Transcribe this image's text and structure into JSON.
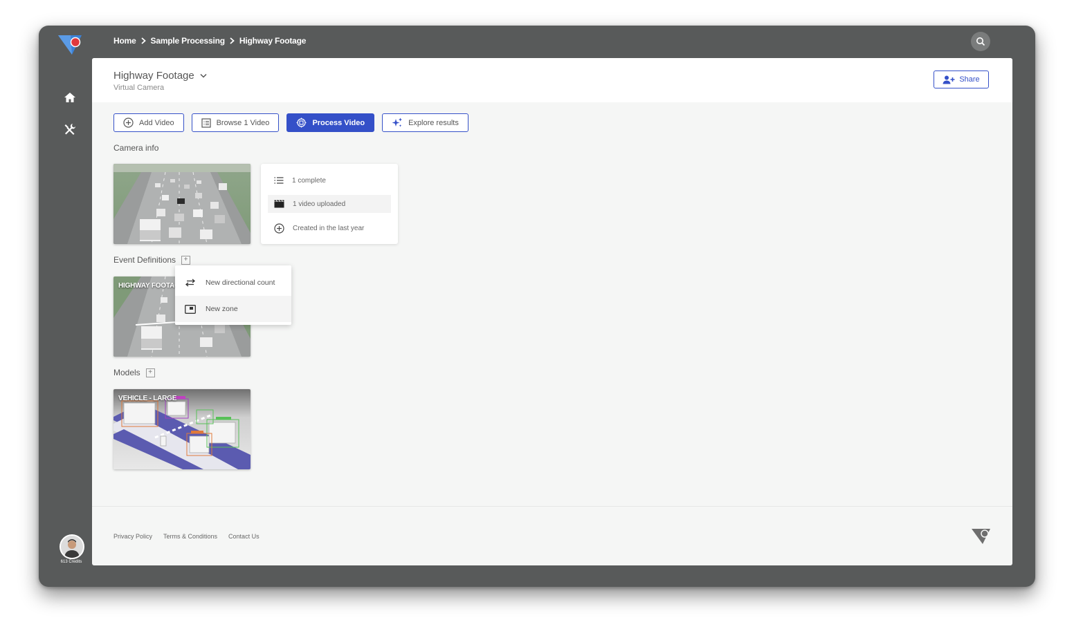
{
  "breadcrumb": [
    "Home",
    "Sample Processing",
    "Highway Footage"
  ],
  "header": {
    "title": "Highway Footage",
    "subtitle": "Virtual Camera",
    "share_label": "Share"
  },
  "toolbar": {
    "add_video": "Add Video",
    "browse_video": "Browse 1 Video",
    "process_video": "Process Video",
    "explore_results": "Explore results"
  },
  "sections": {
    "camera_info": "Camera info",
    "event_definitions": "Event Definitions",
    "models": "Models"
  },
  "camera_info": {
    "items": [
      {
        "icon": "list-icon",
        "text": "1 complete"
      },
      {
        "icon": "clapperboard-icon",
        "text": "1 video uploaded"
      },
      {
        "icon": "plus-circle-icon",
        "text": "Created in the last year"
      }
    ]
  },
  "event_definitions": {
    "thumbnail_label": "HIGHWAY FOOTAG"
  },
  "event_menu": {
    "items": [
      {
        "icon": "swap-arrows-icon",
        "label": "New directional count"
      },
      {
        "icon": "zone-icon",
        "label": "New zone"
      }
    ]
  },
  "models": {
    "thumbnail_label": "VEHICLE - LARGE"
  },
  "sidebar": {
    "credits": "613 Credits"
  },
  "footer": {
    "links": [
      "Privacy Policy",
      "Terms & Conditions",
      "Contact Us"
    ]
  },
  "colors": {
    "accent": "#3450c8",
    "frame": "#585a5a",
    "panel": "#f5f6f5",
    "logo_blue": "#3b82d8",
    "logo_red": "#e0393e"
  }
}
